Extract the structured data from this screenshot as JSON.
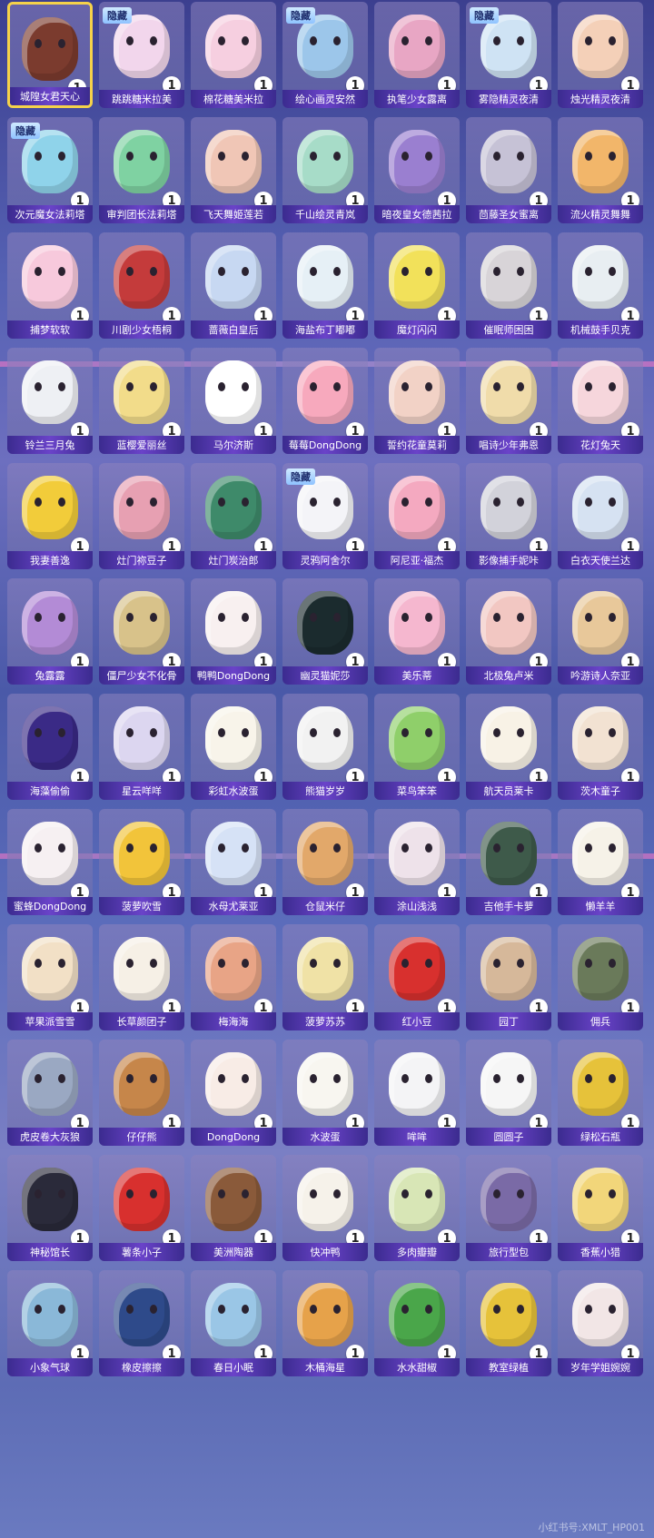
{
  "hidden_label": "隐藏",
  "watermark": "小红书号:XMLT_HP001",
  "items": [
    {
      "name": "城隍女君天心",
      "count": "1",
      "hidden": false,
      "selected": true,
      "color": "#7b3b2e"
    },
    {
      "name": "跳跳糖米拉美",
      "count": "1",
      "hidden": true,
      "color": "#f2d6ec"
    },
    {
      "name": "棉花糖美米拉",
      "count": "1",
      "hidden": false,
      "color": "#f6cfe0"
    },
    {
      "name": "绘心画灵安然",
      "count": "1",
      "hidden": true,
      "color": "#9cc6ea"
    },
    {
      "name": "执笔少女露离",
      "count": "1",
      "hidden": false,
      "color": "#e8a6c4"
    },
    {
      "name": "雾隐精灵夜清",
      "count": "1",
      "hidden": true,
      "color": "#cfe3f4"
    },
    {
      "name": "烛光精灵夜清",
      "count": "1",
      "hidden": false,
      "color": "#f4d0b8"
    },
    {
      "name": "次元魔女法莉塔",
      "count": "1",
      "hidden": true,
      "color": "#8fd3ea"
    },
    {
      "name": "审判团长法莉塔",
      "count": "1",
      "hidden": false,
      "color": "#7fd2a2"
    },
    {
      "name": "飞天舞姬莲若",
      "count": "1",
      "hidden": false,
      "color": "#f0c6b6"
    },
    {
      "name": "千山绘灵青岚",
      "count": "1",
      "hidden": false,
      "color": "#a7dcc8"
    },
    {
      "name": "暗夜皇女德茜拉",
      "count": "1",
      "hidden": false,
      "color": "#9a7fd0"
    },
    {
      "name": "茴藤圣女蜜离",
      "count": "1",
      "hidden": false,
      "color": "#c6c2d6"
    },
    {
      "name": "流火精灵舞舞",
      "count": "1",
      "hidden": false,
      "color": "#f2b66a"
    },
    {
      "name": "捕梦软软",
      "count": "1",
      "hidden": false,
      "color": "#f7c9dc"
    },
    {
      "name": "川剧少女梧桐",
      "count": "1",
      "hidden": false,
      "color": "#c43b3b"
    },
    {
      "name": "蔷薇白皇后",
      "count": "1",
      "hidden": false,
      "color": "#c7d8f2"
    },
    {
      "name": "海盐布丁嘟嘟",
      "count": "1",
      "hidden": false,
      "color": "#e6f0f6"
    },
    {
      "name": "魔灯闪闪",
      "count": "1",
      "hidden": false,
      "color": "#f2e15a"
    },
    {
      "name": "催眠师困困",
      "count": "1",
      "hidden": false,
      "color": "#d8d4d8"
    },
    {
      "name": "机械鼓手贝克",
      "count": "1",
      "hidden": false,
      "color": "#e8eef2"
    },
    {
      "name": "铃兰三月兔",
      "count": "1",
      "hidden": false,
      "color": "#eef0f4"
    },
    {
      "name": "蓝樱爱丽丝",
      "count": "1",
      "hidden": false,
      "color": "#f2dc8a"
    },
    {
      "name": "马尔济斯",
      "count": "1",
      "hidden": false,
      "color": "#ffffff"
    },
    {
      "name": "莓莓DongDong",
      "count": "1",
      "hidden": false,
      "color": "#f7a9bd"
    },
    {
      "name": "誓约花童莫莉",
      "count": "1",
      "hidden": false,
      "color": "#f2d2c6"
    },
    {
      "name": "唱诗少年弗恩",
      "count": "1",
      "hidden": false,
      "color": "#f0dcaa"
    },
    {
      "name": "花灯兔天",
      "count": "1",
      "hidden": false,
      "color": "#f6d6dc"
    },
    {
      "name": "我妻善逸",
      "count": "1",
      "hidden": false,
      "color": "#f2cc3a"
    },
    {
      "name": "灶门祢豆子",
      "count": "1",
      "hidden": false,
      "color": "#e7a0b2"
    },
    {
      "name": "灶门炭治郎",
      "count": "1",
      "hidden": false,
      "color": "#3e8a6a"
    },
    {
      "name": "灵鸦阿舍尔",
      "count": "1",
      "hidden": true,
      "color": "#f4f4f8"
    },
    {
      "name": "阿尼亚·福杰",
      "count": "1",
      "hidden": false,
      "color": "#f4a9c0"
    },
    {
      "name": "影像捕手妮咔",
      "count": "1",
      "hidden": false,
      "color": "#d2d2da"
    },
    {
      "name": "白衣天使兰达",
      "count": "1",
      "hidden": false,
      "color": "#d6e2f2"
    },
    {
      "name": "兔露露",
      "count": "1",
      "hidden": false,
      "color": "#b38bd6"
    },
    {
      "name": "僵尸少女不化骨",
      "count": "1",
      "hidden": false,
      "color": "#d8c28a"
    },
    {
      "name": "鸭鸭DongDong",
      "count": "1",
      "hidden": false,
      "color": "#f8f0f0"
    },
    {
      "name": "幽灵猫妮莎",
      "count": "1",
      "hidden": false,
      "color": "#1b2b2e"
    },
    {
      "name": "美乐蒂",
      "count": "1",
      "hidden": false,
      "color": "#f5b7cf"
    },
    {
      "name": "北极兔卢米",
      "count": "1",
      "hidden": false,
      "color": "#f2c7c2"
    },
    {
      "name": "吟游诗人奈亚",
      "count": "1",
      "hidden": false,
      "color": "#e8c89a"
    },
    {
      "name": "海藻偷偷",
      "count": "1",
      "hidden": false,
      "color": "#3a2a86"
    },
    {
      "name": "星云咩咩",
      "count": "1",
      "hidden": false,
      "color": "#dcd6f0"
    },
    {
      "name": "彩虹水波蛋",
      "count": "1",
      "hidden": false,
      "color": "#f8f4ea"
    },
    {
      "name": "熊猫岁岁",
      "count": "1",
      "hidden": false,
      "color": "#f2f2f2"
    },
    {
      "name": "菜鸟笨笨",
      "count": "1",
      "hidden": false,
      "color": "#8fcf6a"
    },
    {
      "name": "航天员莱卡",
      "count": "1",
      "hidden": false,
      "color": "#f8f2e6"
    },
    {
      "name": "茨木童子",
      "count": "1",
      "hidden": false,
      "color": "#f2e2d2"
    },
    {
      "name": "蜜蜂DongDong",
      "count": "1",
      "hidden": false,
      "color": "#f6f0f2"
    },
    {
      "name": "菠萝吹雪",
      "count": "1",
      "hidden": false,
      "color": "#f2c43a"
    },
    {
      "name": "水母尤莱亚",
      "count": "1",
      "hidden": false,
      "color": "#d6e2f6"
    },
    {
      "name": "仓鼠米仔",
      "count": "1",
      "hidden": false,
      "color": "#e2a86a"
    },
    {
      "name": "涂山浅浅",
      "count": "1",
      "hidden": false,
      "color": "#eee2ea"
    },
    {
      "name": "吉他手卡萝",
      "count": "1",
      "hidden": false,
      "color": "#3e5a4a"
    },
    {
      "name": "懒羊羊",
      "count": "1",
      "hidden": false,
      "color": "#f6f2e8"
    },
    {
      "name": "苹果派雪雪",
      "count": "1",
      "hidden": false,
      "color": "#f2e0c6"
    },
    {
      "name": "长草颜团子",
      "count": "1",
      "hidden": false,
      "color": "#f6f0e6"
    },
    {
      "name": "梅海海",
      "count": "1",
      "hidden": false,
      "color": "#e8a486"
    },
    {
      "name": "菠萝苏苏",
      "count": "1",
      "hidden": false,
      "color": "#f0e2a6"
    },
    {
      "name": "红小豆",
      "count": "1",
      "hidden": false,
      "color": "#d8302e"
    },
    {
      "name": "园丁",
      "count": "1",
      "hidden": false,
      "color": "#d6b89a"
    },
    {
      "name": "佣兵",
      "count": "1",
      "hidden": false,
      "color": "#6a7a5a"
    },
    {
      "name": "虎皮卷大灰狼",
      "count": "1",
      "hidden": false,
      "color": "#9aa8c2"
    },
    {
      "name": "仔仔熊",
      "count": "1",
      "hidden": false,
      "color": "#c6864a"
    },
    {
      "name": "DongDong",
      "count": "1",
      "hidden": false,
      "color": "#f8ece6"
    },
    {
      "name": "水波蛋",
      "count": "1",
      "hidden": false,
      "color": "#f8f6f0"
    },
    {
      "name": "哞哞",
      "count": "1",
      "hidden": false,
      "color": "#f4f4f6"
    },
    {
      "name": "圆圆子",
      "count": "1",
      "hidden": false,
      "color": "#f6f6f6"
    },
    {
      "name": "绿松石瓶",
      "count": "1",
      "hidden": false,
      "color": "#e6c23a"
    },
    {
      "name": "神秘馆长",
      "count": "1",
      "hidden": false,
      "color": "#2a2a3a"
    },
    {
      "name": "薯条小子",
      "count": "1",
      "hidden": false,
      "color": "#d8302e"
    },
    {
      "name": "美洲陶器",
      "count": "1",
      "hidden": false,
      "color": "#8a5a3a"
    },
    {
      "name": "快冲鸭",
      "count": "1",
      "hidden": false,
      "color": "#f6f2ea"
    },
    {
      "name": "多肉瓣瓣",
      "count": "1",
      "hidden": false,
      "color": "#d8e6b6"
    },
    {
      "name": "旅行型包",
      "count": "1",
      "hidden": false,
      "color": "#7a6aa6"
    },
    {
      "name": "香蕉小猎",
      "count": "1",
      "hidden": false,
      "color": "#f2d67a"
    },
    {
      "name": "小象气球",
      "count": "1",
      "hidden": false,
      "color": "#8ab8d8"
    },
    {
      "name": "橡皮擦擦",
      "count": "1",
      "hidden": false,
      "color": "#2e4a8a"
    },
    {
      "name": "春日小眠",
      "count": "1",
      "hidden": false,
      "color": "#9ac6e6"
    },
    {
      "name": "木桶海星",
      "count": "1",
      "hidden": false,
      "color": "#e6a24a"
    },
    {
      "name": "水水甜椒",
      "count": "1",
      "hidden": false,
      "color": "#4aa64a"
    },
    {
      "name": "教室绿植",
      "count": "1",
      "hidden": false,
      "color": "#e6c23a"
    },
    {
      "name": "岁年学姐婉婉",
      "count": "1",
      "hidden": false,
      "color": "#f2e6e6"
    }
  ]
}
